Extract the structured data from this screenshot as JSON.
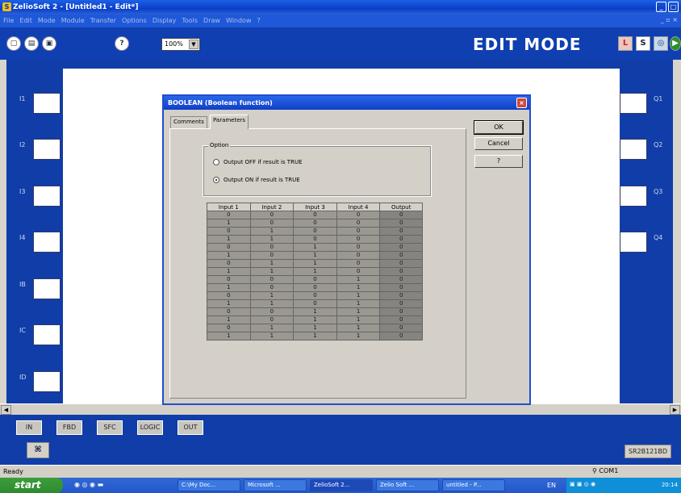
{
  "window": {
    "title": "ZelioSoft 2 - [Untitled1 - Edit*]"
  },
  "menu": [
    "File",
    "Edit",
    "Mode",
    "Module",
    "Transfer",
    "Options",
    "Display",
    "Tools",
    "Draw",
    "Window",
    "?"
  ],
  "toolbar": {
    "zoom": "100%",
    "mode_label": "EDIT MODE"
  },
  "inputs": [
    "I1",
    "I2",
    "I3",
    "I4",
    "IB",
    "IC",
    "ID"
  ],
  "outputs": [
    "Q1",
    "Q2",
    "Q3",
    "Q4"
  ],
  "dialog": {
    "title": "BOOLEAN (Boolean function)",
    "tabs": [
      "Comments",
      "Parameters"
    ],
    "active_tab": "Parameters",
    "option_legend": "Option",
    "radio_off": "Output OFF if result is TRUE",
    "radio_on": "Output ON if result is TRUE",
    "selected_option": "radio_on",
    "buttons": {
      "ok": "OK",
      "cancel": "Cancel",
      "help": "?"
    },
    "table": {
      "headers": [
        "Input 1",
        "Input 2",
        "Input 3",
        "Input 4",
        "Output"
      ],
      "rows": [
        [
          "0",
          "0",
          "0",
          "0",
          "0"
        ],
        [
          "1",
          "0",
          "0",
          "0",
          "0"
        ],
        [
          "0",
          "1",
          "0",
          "0",
          "0"
        ],
        [
          "1",
          "1",
          "0",
          "0",
          "0"
        ],
        [
          "0",
          "0",
          "1",
          "0",
          "0"
        ],
        [
          "1",
          "0",
          "1",
          "0",
          "0"
        ],
        [
          "0",
          "1",
          "1",
          "0",
          "0"
        ],
        [
          "1",
          "1",
          "1",
          "0",
          "0"
        ],
        [
          "0",
          "0",
          "0",
          "1",
          "0"
        ],
        [
          "1",
          "0",
          "0",
          "1",
          "0"
        ],
        [
          "0",
          "1",
          "0",
          "1",
          "0"
        ],
        [
          "1",
          "1",
          "0",
          "1",
          "0"
        ],
        [
          "0",
          "0",
          "1",
          "1",
          "0"
        ],
        [
          "1",
          "0",
          "1",
          "1",
          "0"
        ],
        [
          "0",
          "1",
          "1",
          "1",
          "0"
        ],
        [
          "1",
          "1",
          "1",
          "1",
          "0"
        ]
      ]
    }
  },
  "categories": [
    "IN",
    "FBD",
    "SFC",
    "LOGIC",
    "OUT"
  ],
  "module_name": "SR2B121BD",
  "status": {
    "text": "Ready",
    "port": "COM1"
  },
  "taskbar": {
    "start": "start",
    "tasks": [
      "C:\\My Doc...",
      "Microsoft ...",
      "ZelioSoft 2...",
      "Zelio Soft ...",
      "untitled - P..."
    ],
    "lang": "EN",
    "time": "20:14"
  }
}
